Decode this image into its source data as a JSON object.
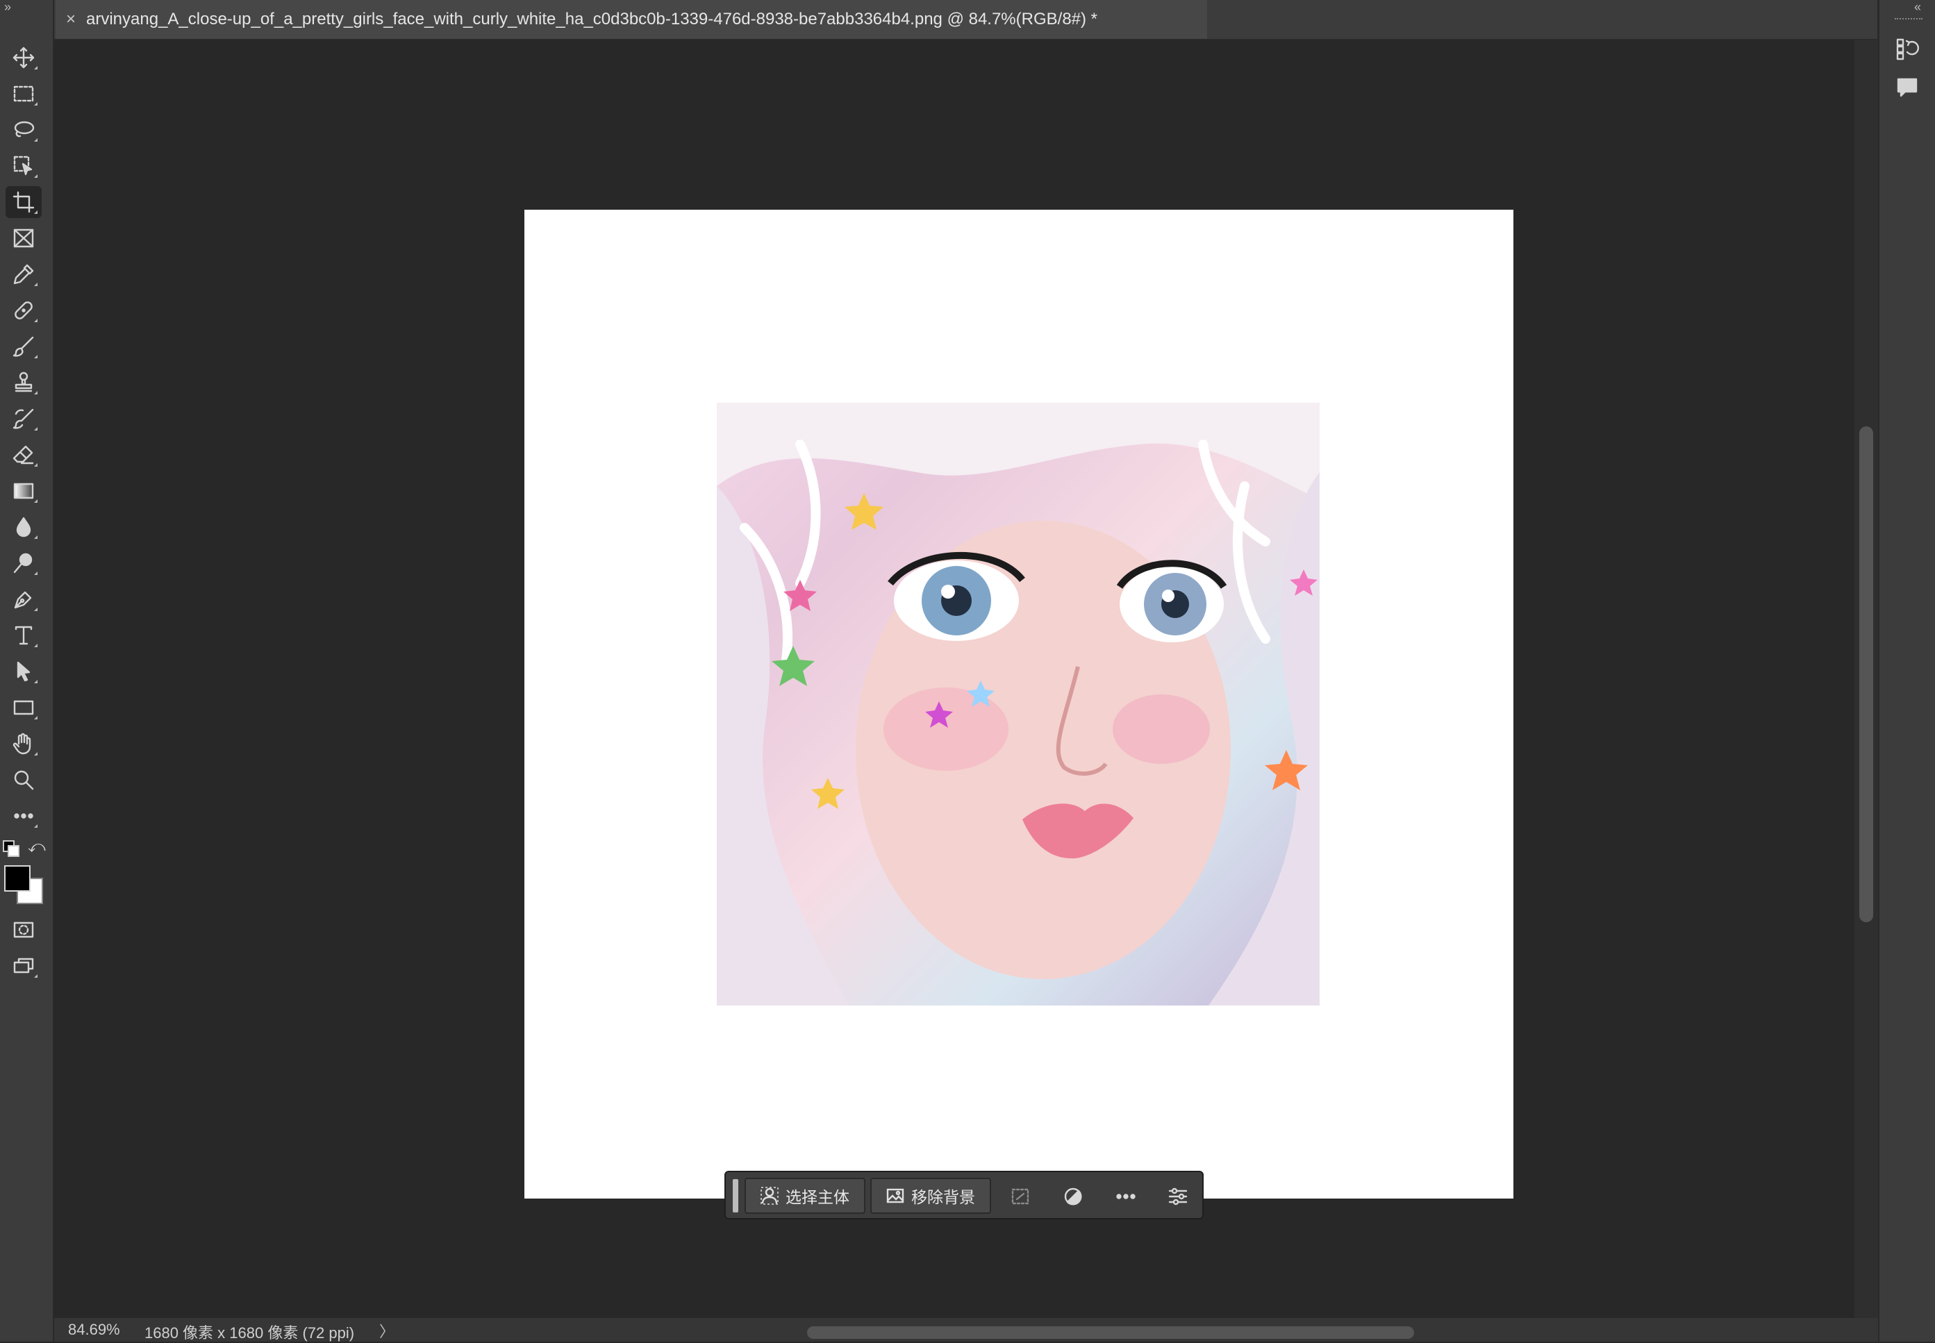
{
  "document": {
    "tab_title": "arvinyang_A_close-up_of_a_pretty_girls_face_with_curly_white_ha_c0d3bc0b-1339-476d-8938-be7abb3364b4.png @ 84.7%(RGB/8#) *",
    "close_glyph": "×"
  },
  "toolbar": {
    "collapse_glyph": "»",
    "tools": [
      {
        "name": "move-tool",
        "icon": "move-icon"
      },
      {
        "name": "marquee-tool",
        "icon": "rectangular-marquee-icon"
      },
      {
        "name": "lasso-tool",
        "icon": "lasso-icon"
      },
      {
        "name": "object-selection-tool",
        "icon": "object-selection-icon"
      },
      {
        "name": "crop-tool",
        "icon": "crop-icon",
        "active": true
      },
      {
        "name": "frame-tool",
        "icon": "frame-icon"
      },
      {
        "name": "eyedropper-tool",
        "icon": "eyedropper-icon"
      },
      {
        "name": "healing-brush-tool",
        "icon": "bandage-icon"
      },
      {
        "name": "brush-tool",
        "icon": "brush-icon"
      },
      {
        "name": "clone-stamp-tool",
        "icon": "stamp-icon"
      },
      {
        "name": "history-brush-tool",
        "icon": "history-brush-icon"
      },
      {
        "name": "eraser-tool",
        "icon": "eraser-icon"
      },
      {
        "name": "gradient-tool",
        "icon": "gradient-icon"
      },
      {
        "name": "blur-tool",
        "icon": "drop-icon"
      },
      {
        "name": "dodge-tool",
        "icon": "dodge-icon"
      },
      {
        "name": "pen-tool",
        "icon": "pen-icon"
      },
      {
        "name": "type-tool",
        "icon": "type-icon"
      },
      {
        "name": "path-selection-tool",
        "icon": "arrow-icon"
      },
      {
        "name": "rectangle-tool",
        "icon": "rectangle-icon"
      },
      {
        "name": "hand-tool",
        "icon": "hand-icon"
      },
      {
        "name": "zoom-tool",
        "icon": "magnifier-icon"
      },
      {
        "name": "more-tools",
        "icon": "ellipsis-icon"
      }
    ],
    "colors": {
      "foreground": "#000000",
      "background": "#ffffff"
    }
  },
  "right_panel": {
    "collapse_glyph": "«",
    "icons": [
      "history-icon",
      "comment-icon"
    ]
  },
  "context_bar": {
    "select_subject": "选择主体",
    "remove_background": "移除背景"
  },
  "status": {
    "zoom": "84.69%",
    "doc_info": "1680 像素 x 1680 像素 (72 ppi)",
    "arrow": "〉"
  }
}
